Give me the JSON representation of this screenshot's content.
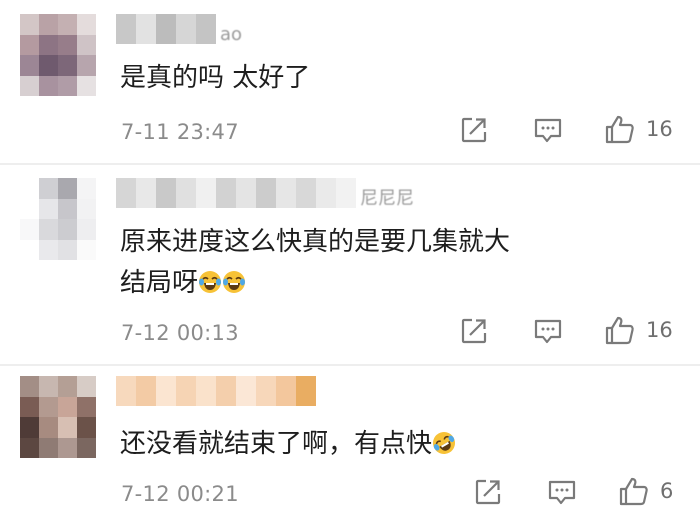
{
  "comments": [
    {
      "username_fragment": "ao",
      "text_lines": [
        "是真的吗 太好了"
      ],
      "time": "7-11 23:47",
      "likes": "16",
      "avatar_pixels": [
        "#d3c6c6",
        "#b9a2a6",
        "#c4b0b2",
        "#e4dcdc",
        "#b49aa0",
        "#8d7484",
        "#977d8a",
        "#cfc3c6",
        "#9c8695",
        "#6f5a6e",
        "#7d6779",
        "#b7a5ad",
        "#d7cfd1",
        "#a8929f",
        "#b09ca7",
        "#e6e1e2"
      ],
      "username_pixels": [
        "#c8c8c8",
        "#e2e2e2",
        "#bcbcbc",
        "#d6d6d6",
        "#c4c4c4"
      ]
    },
    {
      "username_fragment": "尼尼尼",
      "text_lines": [
        "原来进度这么快真的是要几集就大",
        "结局呀"
      ],
      "time": "7-12 00:13",
      "likes": "16",
      "avatar_pixels": [
        "#ffffff",
        "#cfcfd3",
        "#a9a8ae",
        "#f4f4f5",
        "#ffffff",
        "#e6e6e9",
        "#c7c6cb",
        "#f2f2f3",
        "#f8f8f9",
        "#d9d9dc",
        "#ccccd0",
        "#eeeef0",
        "#ffffff",
        "#e9e9ec",
        "#e1e1e4",
        "#fafafa"
      ],
      "username_pixels": [
        "#d6d6d6",
        "#e8e8e8",
        "#c9c9c9",
        "#e0e0e0",
        "#f0f0f0",
        "#d2d2d2",
        "#e4e4e4",
        "#cccccc",
        "#e6e6e6",
        "#d8d8d8",
        "#eaeaea",
        "#f2f2f2"
      ]
    },
    {
      "username_fragment": "",
      "text_lines": [
        "还没看就结束了啊，有点快"
      ],
      "time": "7-12 00:21",
      "likes": "6",
      "avatar_pixels": [
        "#a38e86",
        "#c7b7b0",
        "#b49f95",
        "#d7ccc6",
        "#7a5c54",
        "#b39a90",
        "#c8a598",
        "#8f7168",
        "#4f3b37",
        "#a78b80",
        "#d7bfb3",
        "#6b5249",
        "#5c4741",
        "#8f7b74",
        "#ad9891",
        "#7b6760"
      ],
      "username_pixels": [
        "#f7d9bd",
        "#f3cba5",
        "#fbe5d1",
        "#f6d4b4",
        "#fae2cb",
        "#f4cfac",
        "#fbe7d6",
        "#f7d7ba",
        "#f3c79d",
        "#e9ad62"
      ]
    }
  ],
  "emojis": {
    "laugh_cry": "face-with-tears-of-joy",
    "rofl": "rolling-on-the-floor-laughing"
  },
  "icons": {
    "share": "share-icon",
    "comment": "comment-icon",
    "like": "thumbs-up-icon"
  },
  "colors": {
    "text": "#1e1e1e",
    "meta": "#8b8b8b",
    "icon": "#7a7a7a",
    "divider": "#eeeeee",
    "emoji_face": "#f7c237",
    "emoji_tear": "#4fa8e6"
  }
}
